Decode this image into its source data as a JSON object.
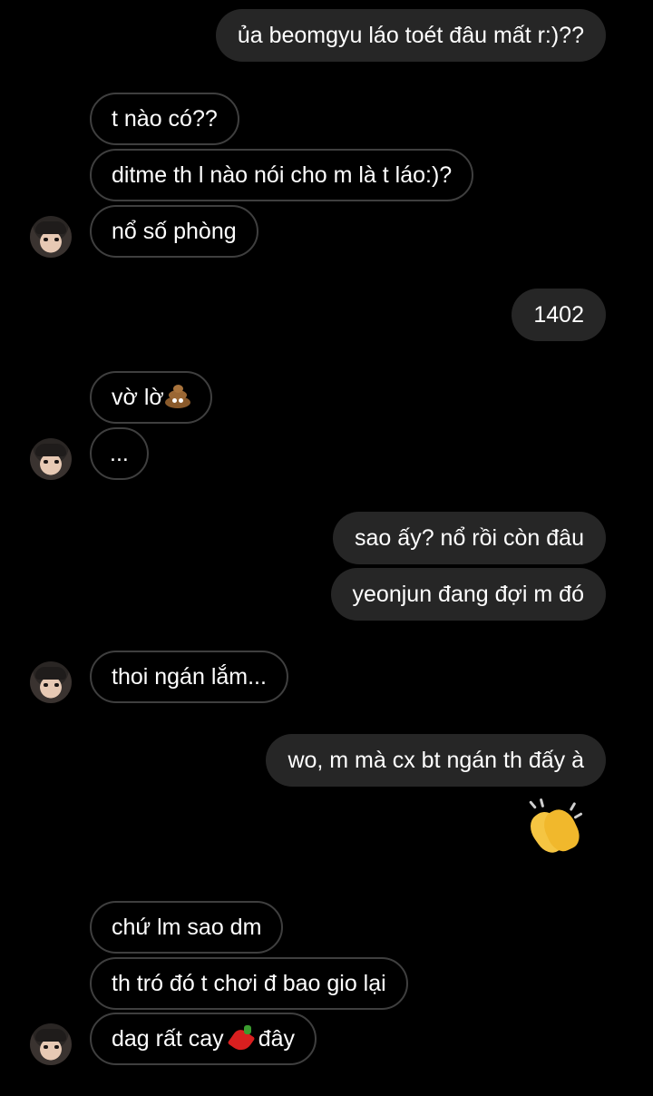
{
  "messages": [
    {
      "dir": "out",
      "text": "ủa beomgyu láo toét đâu mất r:)??"
    },
    {
      "dir": "in",
      "text": "t nào có??"
    },
    {
      "dir": "in",
      "text": "ditme th l nào nói cho m là t láo:)?"
    },
    {
      "dir": "in",
      "text": "nổ số phòng"
    },
    {
      "dir": "out",
      "text": "1402"
    },
    {
      "dir": "in",
      "text": "vờ lờ",
      "emoji": "pile-of-poo"
    },
    {
      "dir": "in",
      "text": "..."
    },
    {
      "dir": "out",
      "text": "sao ấy? nổ rồi còn đâu"
    },
    {
      "dir": "out",
      "text": "yeonjun đang đợi m đó"
    },
    {
      "dir": "in",
      "text": "thoi ngán lắm..."
    },
    {
      "dir": "out",
      "text": "wo, m mà cx bt ngán th đấy à"
    },
    {
      "dir": "out",
      "emoji": "clapping-hands"
    },
    {
      "dir": "in",
      "text": "chứ lm sao dm"
    },
    {
      "dir": "in",
      "text": "th tró đó t chơi đ bao gio lại"
    },
    {
      "dir": "in",
      "text": "dag rất cay",
      "emoji": "hot-pepper",
      "text_after": "đây"
    }
  ],
  "colors": {
    "background": "#000000",
    "outgoing_bubble": "#262626",
    "incoming_border": "#3f3f3f",
    "text": "#ffffff"
  }
}
